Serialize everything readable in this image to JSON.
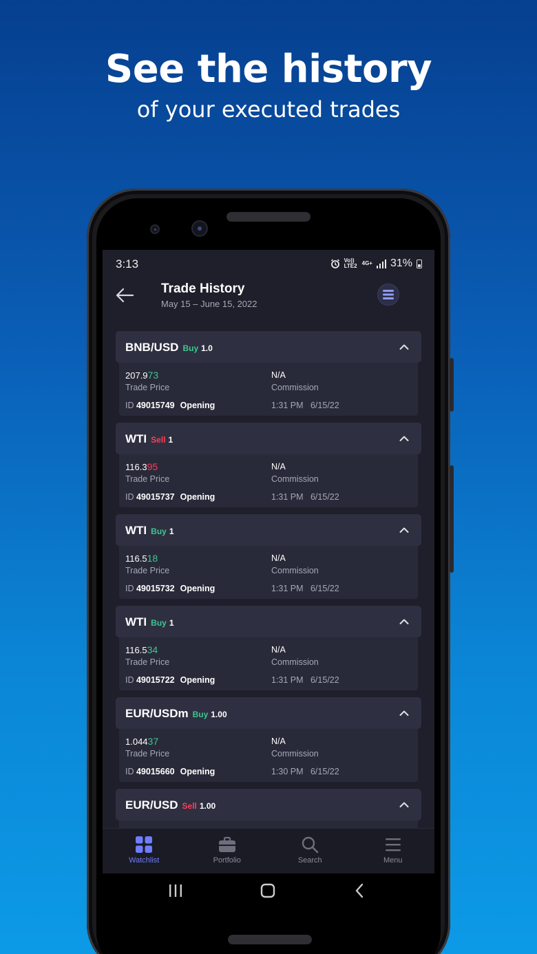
{
  "promo": {
    "headline": "See the history",
    "subline": "of your executed trades"
  },
  "status_bar": {
    "time": "3:13",
    "volte": "Vo)) LTE2",
    "network": "4G+",
    "battery": "31%"
  },
  "header": {
    "title": "Trade History",
    "date_range": "May 15 – June 15, 2022"
  },
  "colors": {
    "buy": "#3cc88f",
    "sell": "#ff3d57",
    "accent": "#6f7dff"
  },
  "trades": [
    {
      "symbol": "BNB/USD",
      "side": "Buy",
      "qty": "1.0",
      "price_main": "207.9",
      "price_hi": "73",
      "price_label": "Trade Price",
      "commission": "N/A",
      "commission_label": "Commission",
      "id_prefix": "ID",
      "id": "49015749",
      "type": "Opening",
      "time": "1:31 PM",
      "date": "6/15/22"
    },
    {
      "symbol": "WTI",
      "side": "Sell",
      "qty": "1",
      "price_main": "116.3",
      "price_hi": "95",
      "price_label": "Trade Price",
      "commission": "N/A",
      "commission_label": "Commission",
      "id_prefix": "ID",
      "id": "49015737",
      "type": "Opening",
      "time": "1:31 PM",
      "date": "6/15/22"
    },
    {
      "symbol": "WTI",
      "side": "Buy",
      "qty": "1",
      "price_main": "116.5",
      "price_hi": "18",
      "price_label": "Trade Price",
      "commission": "N/A",
      "commission_label": "Commission",
      "id_prefix": "ID",
      "id": "49015732",
      "type": "Opening",
      "time": "1:31 PM",
      "date": "6/15/22"
    },
    {
      "symbol": "WTI",
      "side": "Buy",
      "qty": "1",
      "price_main": "116.5",
      "price_hi": "34",
      "price_label": "Trade Price",
      "commission": "N/A",
      "commission_label": "Commission",
      "id_prefix": "ID",
      "id": "49015722",
      "type": "Opening",
      "time": "1:31 PM",
      "date": "6/15/22"
    },
    {
      "symbol": "EUR/USDm",
      "side": "Buy",
      "qty": "1.00",
      "price_main": "1.044",
      "price_hi": "37",
      "price_label": "Trade Price",
      "commission": "N/A",
      "commission_label": "Commission",
      "id_prefix": "ID",
      "id": "49015660",
      "type": "Opening",
      "time": "1:30 PM",
      "date": "6/15/22"
    },
    {
      "symbol": "EUR/USD",
      "side": "Sell",
      "qty": "1.00"
    }
  ],
  "tabs": [
    {
      "label": "Watchlist",
      "icon": "grid-icon",
      "active": true
    },
    {
      "label": "Portfolio",
      "icon": "briefcase-icon",
      "active": false
    },
    {
      "label": "Search",
      "icon": "search-icon",
      "active": false
    },
    {
      "label": "Menu",
      "icon": "menu-icon",
      "active": false
    }
  ]
}
